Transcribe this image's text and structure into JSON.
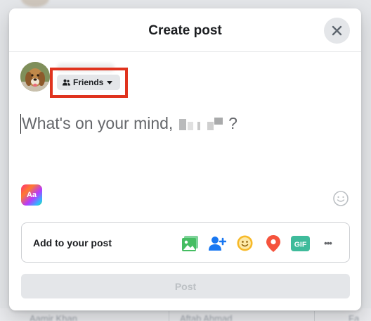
{
  "modal": {
    "title": "Create post",
    "audience_label": "Friends",
    "composer_placeholder_prefix": "What's on your mind,",
    "composer_placeholder_suffix": "?",
    "text_format_label": "Aa",
    "add_to_post_label": "Add to your post",
    "add_to_post_icons": [
      "photo-video-icon",
      "tag-people-icon",
      "feeling-activity-icon",
      "check-in-icon",
      "gif-icon",
      "more-icon"
    ],
    "more_label": "•••",
    "post_button_label": "Post"
  },
  "background": {
    "names": [
      "Aamir Khan",
      "Aftab Ahmad",
      "Fa Riz"
    ]
  },
  "colors": {
    "highlight": "#e0331e",
    "photo_green": "#45bd62",
    "tag_blue": "#1877f2",
    "feeling_yellow": "#f7b928",
    "checkin_red": "#f5533d",
    "gif_teal": "#3fbb9b"
  }
}
